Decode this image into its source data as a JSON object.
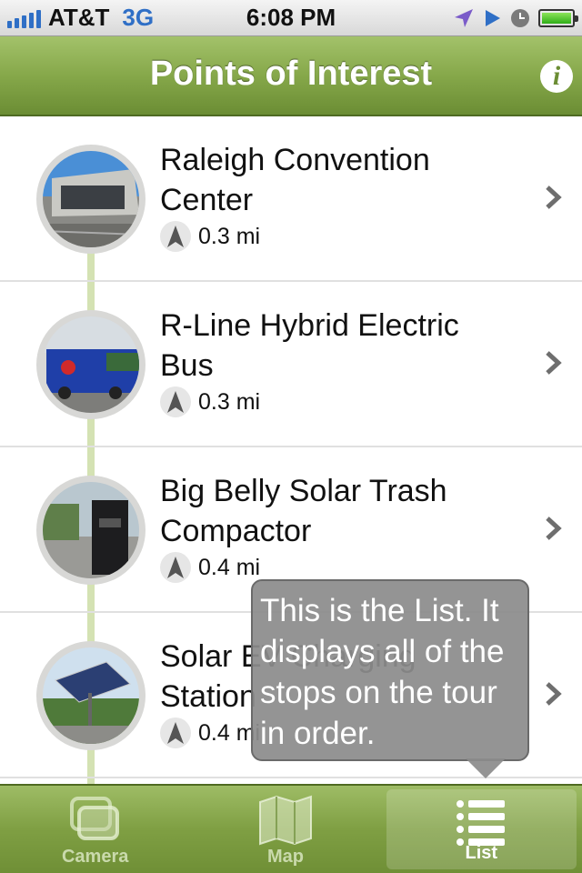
{
  "status_bar": {
    "carrier": "AT&T",
    "network": "3G",
    "time": "6:08 PM",
    "icons": [
      "signal-bars-icon",
      "location-arrow-icon",
      "play-icon",
      "alarm-clock-icon",
      "battery-icon"
    ]
  },
  "nav": {
    "title": "Points of Interest",
    "info_icon": "info-icon",
    "info_glyph": "i"
  },
  "list": {
    "items": [
      {
        "title": "Raleigh Convention Center",
        "distance": "0.3 mi",
        "thumb": "convention-center-photo"
      },
      {
        "title": "R-Line Hybrid Electric Bus",
        "distance": "0.3 mi",
        "thumb": "r-line-bus-photo"
      },
      {
        "title": "Big Belly Solar Trash Compactor",
        "distance": "0.4 mi",
        "thumb": "trash-compactor-photo"
      },
      {
        "title": "Solar EV Charging Station",
        "distance": "0.4 mi",
        "thumb": "solar-panel-photo"
      }
    ]
  },
  "tooltip": {
    "text": "This is the List. It displays all of the stops on the tour in order."
  },
  "tabs": [
    {
      "label": "Camera",
      "icon": "camera-icon",
      "active": false
    },
    {
      "label": "Map",
      "icon": "map-icon",
      "active": false
    },
    {
      "label": "List",
      "icon": "list-icon",
      "active": true
    }
  ],
  "colors": {
    "nav_green": "#86a84a",
    "timeline": "#d4e2b3",
    "status_blue": "#2f6fc6"
  }
}
